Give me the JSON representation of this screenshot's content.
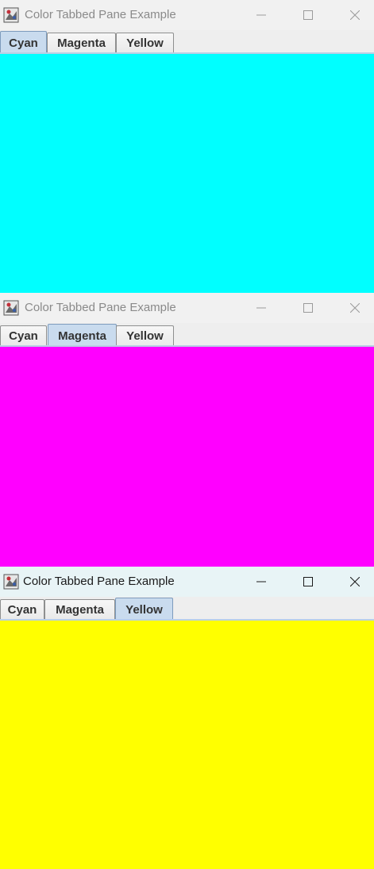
{
  "windows": [
    {
      "title": "Color Tabbed Pane Example",
      "tabs": [
        "Cyan",
        "Magenta",
        "Yellow"
      ],
      "selected_tab": "Cyan",
      "content_color": "#00ffff"
    },
    {
      "title": "Color Tabbed Pane Example",
      "tabs": [
        "Cyan",
        "Magenta",
        "Yellow"
      ],
      "selected_tab": "Magenta",
      "content_color": "#ff00ff"
    },
    {
      "title": "Color Tabbed Pane Example",
      "tabs": [
        "Cyan",
        "Magenta",
        "Yellow"
      ],
      "selected_tab": "Yellow",
      "content_color": "#ffff00"
    }
  ],
  "icons": {
    "app": "java-app-icon",
    "minimize": "minimize-icon",
    "maximize": "maximize-icon",
    "close": "close-icon"
  },
  "colors": {
    "tab_selected": "#c9dbee",
    "tab_normal": "#eeeeee",
    "titlebar_active": "#e8f4f6",
    "titlebar_inactive": "#f1f1f1"
  }
}
